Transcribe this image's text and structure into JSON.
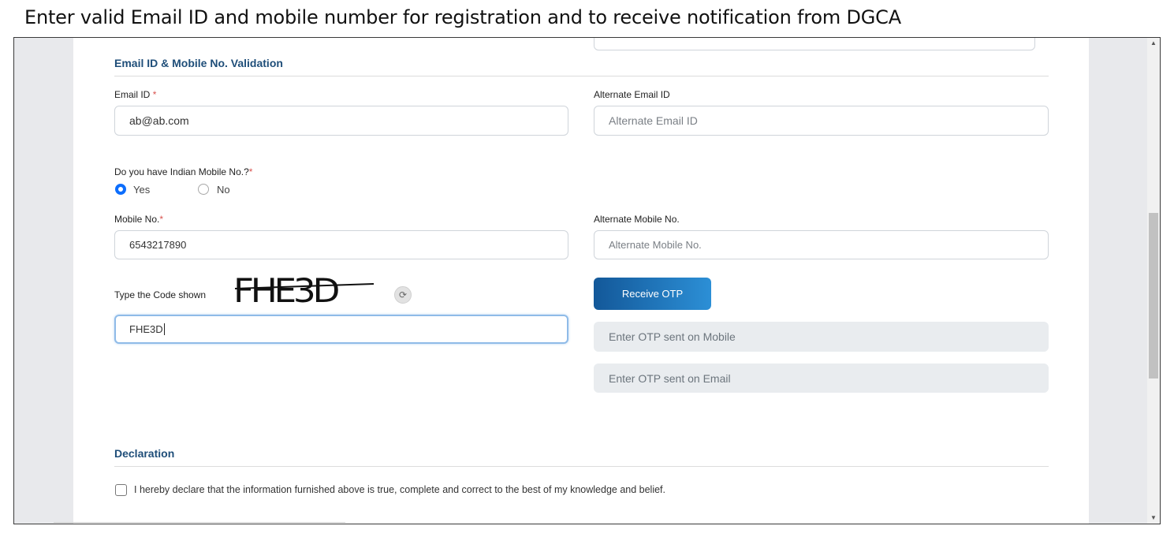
{
  "caption": "Enter valid Email ID and mobile number for registration and to receive notification from DGCA",
  "section_email": {
    "title": "Email ID & Mobile No. Validation",
    "email_label": "Email ID",
    "email_value": "ab@ab.com",
    "alt_email_label": "Alternate Email ID",
    "alt_email_placeholder": "Alternate Email ID",
    "indian_mobile_question": "Do you have Indian Mobile No.?",
    "radio_yes": "Yes",
    "radio_no": "No",
    "radio_selected": "Yes",
    "mobile_label": "Mobile No.",
    "mobile_value": "6543217890",
    "alt_mobile_label": "Alternate Mobile No.",
    "alt_mobile_placeholder": "Alternate Mobile No.",
    "captcha_label": "Type the Code shown",
    "captcha_code": "FHE3D",
    "captcha_input_value": "FHE3D",
    "receive_otp_label": "Receive OTP",
    "otp_mobile_placeholder": "Enter OTP sent on Mobile",
    "otp_email_placeholder": "Enter OTP sent on Email",
    "required_mark": "*"
  },
  "section_declaration": {
    "title": "Declaration",
    "text": "I hereby declare that the information furnished above is true, complete and correct to the best of my knowledge and belief."
  },
  "icons": {
    "refresh": "refresh-icon",
    "scroll_up": "triangle-up-icon",
    "scroll_down": "triangle-down-icon"
  }
}
